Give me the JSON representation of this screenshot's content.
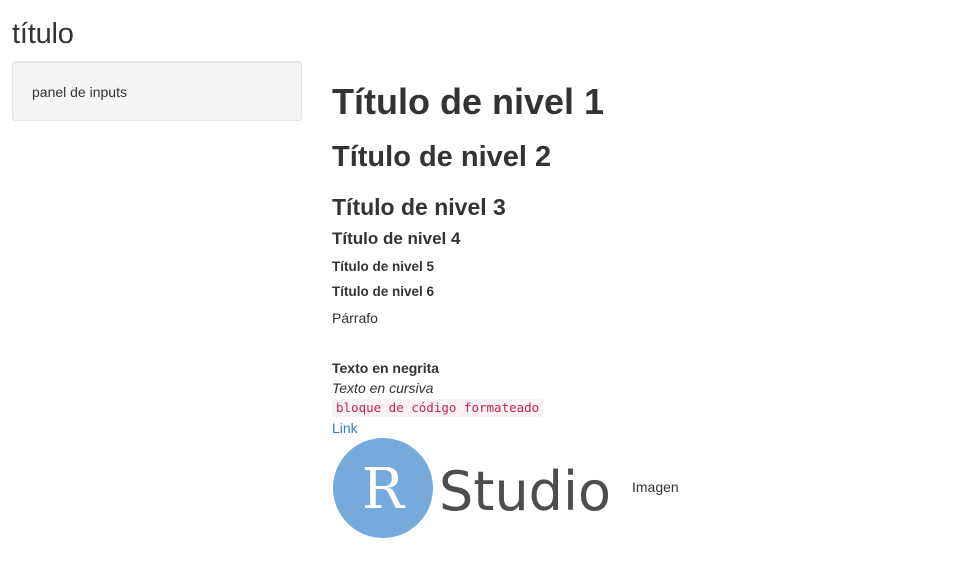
{
  "app": {
    "title": "título"
  },
  "sidebar": {
    "panel_label": "panel de inputs"
  },
  "main": {
    "h1": "Título de nivel 1",
    "h2": "Título de nivel 2",
    "h3": "Título de nivel 3",
    "h4": "Título de nivel 4",
    "h5": "Título de nivel 5",
    "h6": "Título de nivel 6",
    "paragraph": "Párrafo",
    "bold_text": "Texto en negrita",
    "italic_text": "Texto en cursiva",
    "code_text": "bloque de código formateado",
    "link_text": "Link",
    "image": {
      "logo_letter": "R",
      "logo_word": "Studio",
      "logo_circle_color": "#75aadb",
      "logo_text_color": "#4d4d4d",
      "caption": "Imagen"
    }
  }
}
